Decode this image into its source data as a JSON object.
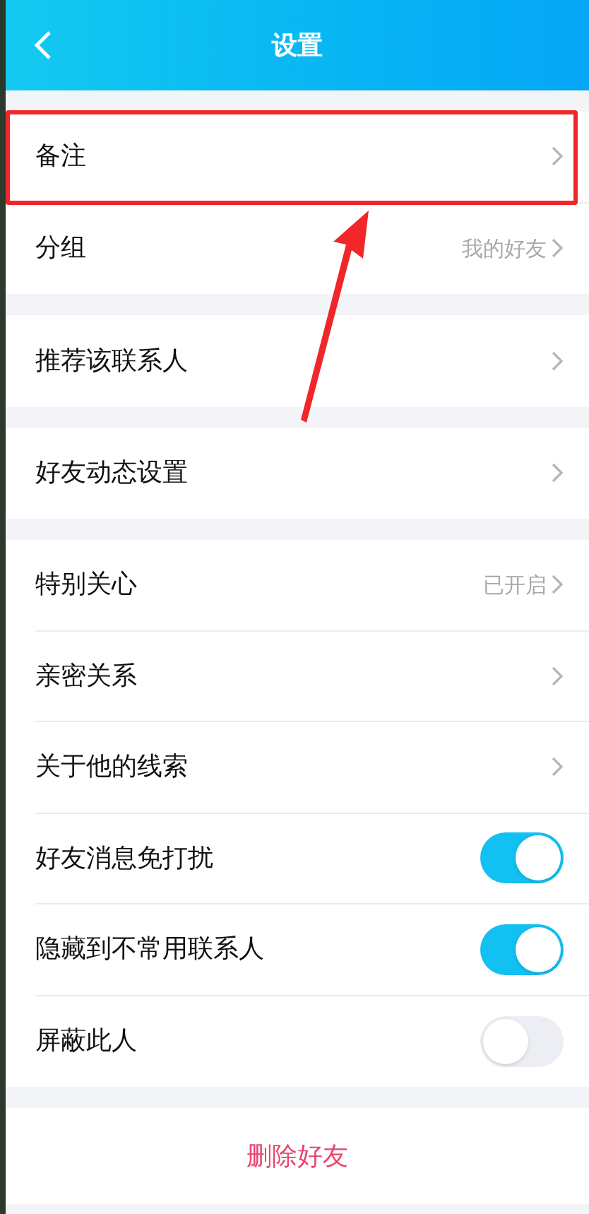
{
  "header": {
    "title": "设置"
  },
  "sections": [
    {
      "items": [
        {
          "kind": "link",
          "label": "备注",
          "highlighted": true
        },
        {
          "kind": "link",
          "label": "分组",
          "value": "我的好友",
          "highlighted": false
        }
      ]
    },
    {
      "items": [
        {
          "kind": "link",
          "label": "推荐该联系人",
          "highlighted": false
        }
      ]
    },
    {
      "items": [
        {
          "kind": "link",
          "label": "好友动态设置",
          "highlighted": false
        }
      ]
    },
    {
      "items": [
        {
          "kind": "link",
          "label": "特别关心",
          "value": "已开启",
          "highlighted": false
        },
        {
          "kind": "link",
          "label": "亲密关系",
          "highlighted": false
        },
        {
          "kind": "link",
          "label": "关于他的线索",
          "highlighted": false
        },
        {
          "kind": "toggle",
          "label": "好友消息免打扰",
          "on": true,
          "highlighted": false
        },
        {
          "kind": "toggle",
          "label": "隐藏到不常用联系人",
          "on": true,
          "highlighted": false
        },
        {
          "kind": "toggle",
          "label": "屏蔽此人",
          "on": false,
          "highlighted": false
        }
      ]
    }
  ],
  "delete_button": "删除好友"
}
